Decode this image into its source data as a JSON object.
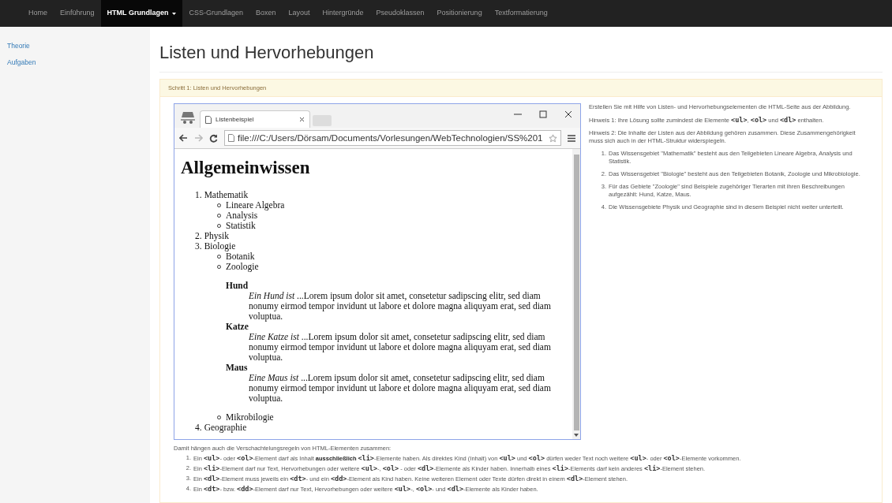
{
  "nav": {
    "items": [
      {
        "label": "Home",
        "selected": false,
        "dropdown": false
      },
      {
        "label": "Einführung",
        "selected": false,
        "dropdown": false
      },
      {
        "label": "HTML Grundlagen",
        "selected": true,
        "dropdown": true
      },
      {
        "label": "CSS-Grundlagen",
        "selected": false,
        "dropdown": false
      },
      {
        "label": "Boxen",
        "selected": false,
        "dropdown": false
      },
      {
        "label": "Layout",
        "selected": false,
        "dropdown": false
      },
      {
        "label": "Hintergründe",
        "selected": false,
        "dropdown": false
      },
      {
        "label": "Pseudoklassen",
        "selected": false,
        "dropdown": false
      },
      {
        "label": "Positionierung",
        "selected": false,
        "dropdown": false
      },
      {
        "label": "Textformatierung",
        "selected": false,
        "dropdown": false
      }
    ]
  },
  "sidebar": {
    "items": [
      {
        "label": "Theorie"
      },
      {
        "label": "Aufgaben"
      }
    ]
  },
  "title": "Listen und Hervorhebungen",
  "panel": {
    "heading": "Schritt 1: Listen und Hervorhebungen"
  },
  "browser": {
    "tab_title": "Listenbeispiel",
    "address": "file:///C:/Users/Dörsam/Documents/Vorlesungen/WebTechnologien/SS%201",
    "heading": "Allgemeinwissen",
    "list": [
      {
        "number": "1.",
        "label": "Mathematik",
        "children": [
          {
            "label": "Lineare Algebra"
          },
          {
            "label": "Analysis"
          },
          {
            "label": "Statistik"
          }
        ]
      },
      {
        "number": "2.",
        "label": "Physik"
      },
      {
        "number": "3.",
        "label": "Biologie",
        "children": [
          {
            "label": "Botanik"
          },
          {
            "label": "Zoologie",
            "definitions": [
              {
                "term": "Hund",
                "intro": "Ein Hund ist",
                "text": " ...Lorem ipsum dolor sit amet, consetetur sadipscing elitr, sed diam nonumy eirmod tempor invidunt ut labore et dolore magna aliquyam erat, sed diam voluptua."
              },
              {
                "term": "Katze",
                "intro": "Eine Katze ist",
                "text": " ...Lorem ipsum dolor sit amet, consetetur sadipscing elitr, sed diam nonumy eirmod tempor invidunt ut labore et dolore magna aliquyam erat, sed diam voluptua."
              },
              {
                "term": "Maus",
                "intro": "Eine Maus ist",
                "text": " ...Lorem ipsum dolor sit amet, consetetur sadipscing elitr, sed diam nonumy eirmod tempor invidunt ut labore et dolore magna aliquyam erat, sed diam voluptua."
              }
            ]
          },
          {
            "label": "Mikrobilogie"
          }
        ]
      },
      {
        "number": "4.",
        "label": "Geographie"
      }
    ]
  },
  "task": {
    "paragraphs": [
      [
        {
          "kind": "text",
          "t": "Erstellen Sie mit Hilfe von Listen- und Hervorhebungselementen die HTML-Seite aus der Abbildung."
        }
      ],
      [
        {
          "kind": "text",
          "t": "Hinweis 1: Ihre Lösung sollte zumindest die Elemente "
        },
        {
          "kind": "code",
          "t": "<ul>"
        },
        {
          "kind": "text",
          "t": ", "
        },
        {
          "kind": "code",
          "t": "<ol>"
        },
        {
          "kind": "text",
          "t": " und "
        },
        {
          "kind": "code",
          "t": "<dl>"
        },
        {
          "kind": "text",
          "t": " enthalten."
        }
      ],
      [
        {
          "kind": "text",
          "t": "Hinweis 2: Die Inhalte der Listen aus der Abbildung gehören zusammen. Diese Zusammengehörigkeit muss sich auch in der HTML-Struktur widerspiegeln."
        }
      ]
    ],
    "points": [
      {
        "number": "1.",
        "text": "Das Wissensgebiet \"Mathematik\" besteht aus den Teilgebieten Lineare Algebra, Analysis und Statistik."
      },
      {
        "number": "2.",
        "text": "Das Wissensgebiet \"Biologie\" besteht aus den Teilgebieten Botanik, Zoologie und Mikrobiologie."
      },
      {
        "number": "3.",
        "text": "Für das Gebiete \"Zoologie\" sind Beispiele zugehöriger Tierarten mit ihren Beschreibungen aufgezählt: Hund, Katze, Maus."
      },
      {
        "number": "4.",
        "text": "Die Wissensgebiete Physik und Geographie sind in diesem Beispiel nicht weiter unterteilt."
      }
    ]
  },
  "rules": {
    "intro": "Damit hängen auch die Verschachtelungsregeln von HTML-Elementen zusammen:",
    "items": [
      {
        "number": "1.",
        "parts": [
          {
            "kind": "text",
            "t": "Ein "
          },
          {
            "kind": "code",
            "t": "<ul>"
          },
          {
            "kind": "text",
            "t": "- oder "
          },
          {
            "kind": "code",
            "t": "<ol>"
          },
          {
            "kind": "text",
            "t": "-Element darf als Inhalt "
          },
          {
            "kind": "strong",
            "t": "ausschließlich"
          },
          {
            "kind": "code",
            "t": "<li>"
          },
          {
            "kind": "text",
            "t": "-Elemente haben. Als direktes Kind (Inhalt) von "
          },
          {
            "kind": "code",
            "t": "<ul>"
          },
          {
            "kind": "text",
            "t": " und "
          },
          {
            "kind": "code",
            "t": "<ol>"
          },
          {
            "kind": "text",
            "t": " dürfen weder Text noch weitere "
          },
          {
            "kind": "code",
            "t": "<ul>"
          },
          {
            "kind": "text",
            "t": "- oder "
          },
          {
            "kind": "code",
            "t": "<ol>"
          },
          {
            "kind": "text",
            "t": "-Elemente vorkommen."
          }
        ]
      },
      {
        "number": "2.",
        "parts": [
          {
            "kind": "text",
            "t": "Ein "
          },
          {
            "kind": "code",
            "t": "<li>"
          },
          {
            "kind": "text",
            "t": "-Element darf nur Text, Hervorhebungen oder weitere "
          },
          {
            "kind": "code",
            "t": "<ul>"
          },
          {
            "kind": "text",
            "t": "-, "
          },
          {
            "kind": "code",
            "t": "<ol>"
          },
          {
            "kind": "text",
            "t": " - oder "
          },
          {
            "kind": "code",
            "t": "<dl>"
          },
          {
            "kind": "text",
            "t": "-Elemente als Kinder haben. Innerhalb eines "
          },
          {
            "kind": "code",
            "t": "<li>"
          },
          {
            "kind": "text",
            "t": "-Elements darf kein anderes "
          },
          {
            "kind": "code",
            "t": "<li>"
          },
          {
            "kind": "text",
            "t": "-Element stehen."
          }
        ]
      },
      {
        "number": "3.",
        "parts": [
          {
            "kind": "text",
            "t": "Ein "
          },
          {
            "kind": "code",
            "t": "<dl>"
          },
          {
            "kind": "text",
            "t": "-Element muss jeweils ein "
          },
          {
            "kind": "code",
            "t": "<dt>"
          },
          {
            "kind": "text",
            "t": "- und ein "
          },
          {
            "kind": "code",
            "t": "<dd>"
          },
          {
            "kind": "text",
            "t": "-Element als Kind haben. Keine weiteren Element oder Texte dürfen direkt in einem "
          },
          {
            "kind": "code",
            "t": "<dl>"
          },
          {
            "kind": "text",
            "t": "-Element stehen."
          }
        ]
      },
      {
        "number": "4.",
        "parts": [
          {
            "kind": "text",
            "t": "Ein "
          },
          {
            "kind": "code",
            "t": "<dt>"
          },
          {
            "kind": "text",
            "t": "- bzw. "
          },
          {
            "kind": "code",
            "t": "<dd>"
          },
          {
            "kind": "text",
            "t": "-Element darf nur Text, Hervorhebungen oder weitere "
          },
          {
            "kind": "code",
            "t": "<ul>"
          },
          {
            "kind": "text",
            "t": "-, "
          },
          {
            "kind": "code",
            "t": "<ol>"
          },
          {
            "kind": "text",
            "t": "- und "
          },
          {
            "kind": "code",
            "t": "<dl>"
          },
          {
            "kind": "text",
            "t": "-Elemente als Kinder haben."
          }
        ]
      }
    ]
  }
}
